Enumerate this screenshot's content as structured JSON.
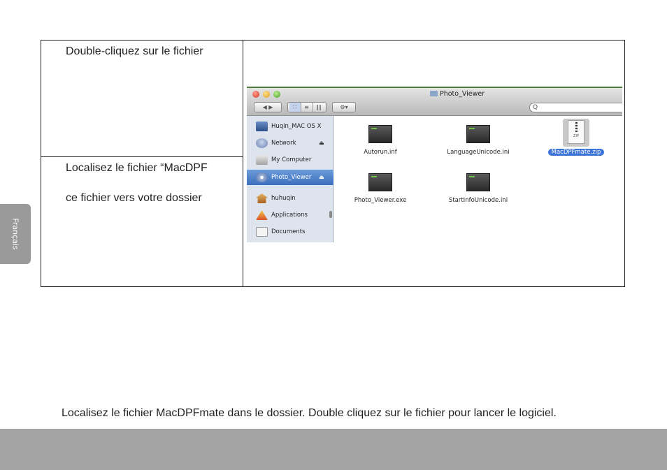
{
  "document": {
    "step1_text": "Double-cliquez sur le fichier",
    "step2_line1": "Localisez le fichier “MacDPF",
    "step2_line2": "ce fichier vers votre dossier",
    "footer_note": "Localisez le fichier MacDPFmate dans le dossier. Double cliquez sur le fichier pour lancer le logiciel.",
    "language_tab": "Français"
  },
  "finder": {
    "window_title": "Photo_Viewer",
    "search_placeholder": "Q",
    "nav_label": "◀ ▶",
    "action_label": "⚙▾",
    "view_labels": [
      "∷",
      "≡",
      "∥∥"
    ],
    "sidebar": [
      {
        "label": "Huqin_MAC OS X",
        "icon": "mac-drive-icon",
        "eject": ""
      },
      {
        "label": "Network",
        "icon": "network-globe-icon",
        "eject": "⏏"
      },
      {
        "label": "My Computer",
        "icon": "computer-icon",
        "eject": ""
      },
      {
        "label": "Photo_Viewer",
        "icon": "disc-icon",
        "eject": "⏏",
        "selected": true
      },
      {
        "label": "huhuqin",
        "icon": "home-icon",
        "eject": ""
      },
      {
        "label": "Applications",
        "icon": "applications-icon",
        "eject": ""
      },
      {
        "label": "Documents",
        "icon": "documents-icon",
        "eject": ""
      }
    ],
    "files": [
      {
        "name": "Autorun.inf",
        "icon": "inf-file-icon"
      },
      {
        "name": "LanguageUnicode.ini",
        "icon": "ini-file-icon"
      },
      {
        "name": "MacDPFmate.zip",
        "icon": "zip-file-icon",
        "selected": true,
        "badge": "ZIP"
      },
      {
        "name": "Photo_Viewer.exe",
        "icon": "exe-file-icon"
      },
      {
        "name": "StartInfoUnicode.ini",
        "icon": "ini-file-icon"
      }
    ]
  }
}
